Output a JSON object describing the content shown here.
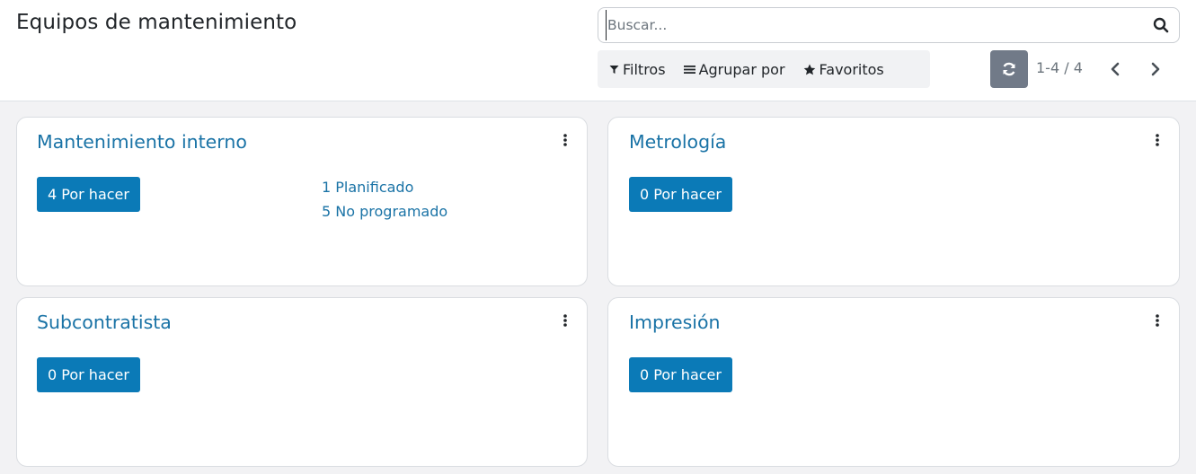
{
  "header": {
    "title": "Equipos de mantenimiento",
    "search_placeholder": "Buscar..."
  },
  "filters": {
    "filters_label": "Filtros",
    "group_by_label": "Agrupar por",
    "favorites_label": "Favoritos"
  },
  "pager": {
    "value": "1-4 / 4"
  },
  "teams": [
    {
      "name": "Mantenimiento interno",
      "todo": "4 Por hacer",
      "planned": "1 Planificado",
      "unscheduled": "5 No programado"
    },
    {
      "name": "Metrología",
      "todo": "0 Por hacer"
    },
    {
      "name": "Subcontratista",
      "todo": "0 Por hacer"
    },
    {
      "name": "Impresión",
      "todo": "0 Por hacer"
    }
  ],
  "colors": {
    "accent": "#0b7ab7",
    "link": "#1a73a6",
    "refresh_bg": "#717a88"
  },
  "icons": [
    "search-icon",
    "filter-icon",
    "list-icon",
    "star-icon",
    "refresh-icon",
    "chevron-left-icon",
    "chevron-right-icon",
    "vertical-dots-icon"
  ]
}
